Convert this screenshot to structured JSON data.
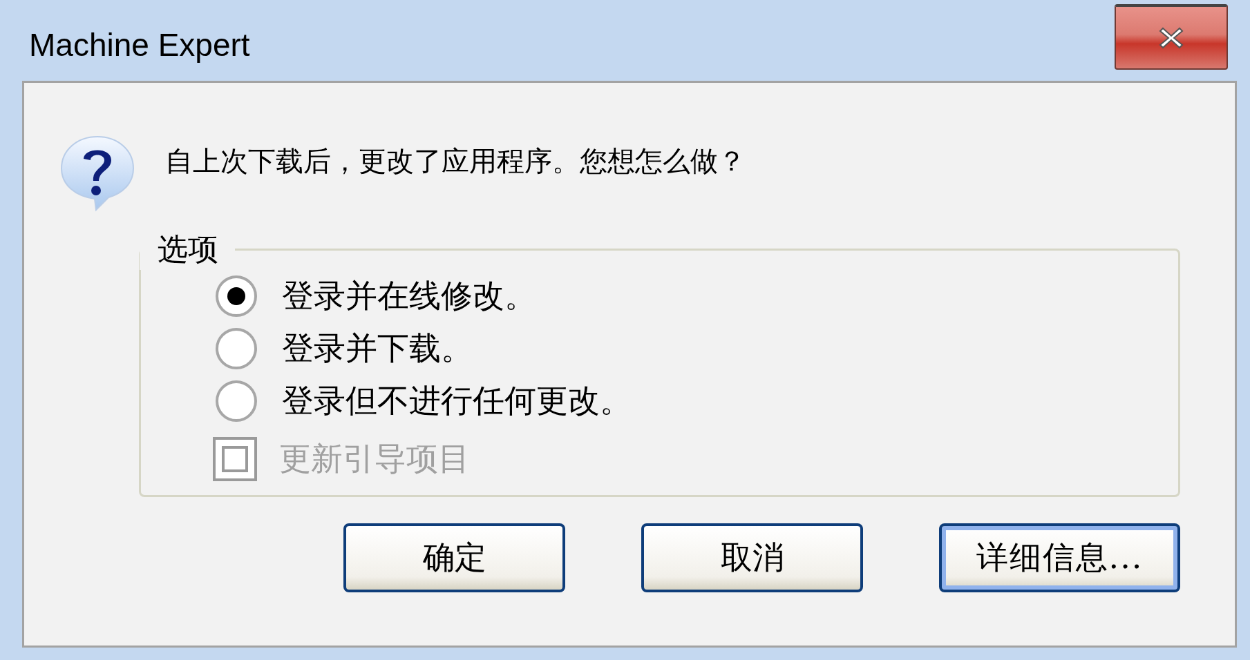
{
  "window": {
    "title": "Machine Expert"
  },
  "message": "自上次下载后，更改了应用程序。您想怎么做？",
  "options": {
    "legend": "选项",
    "items": [
      {
        "kind": "radio",
        "label": "登录并在线修改。",
        "selected": true
      },
      {
        "kind": "radio",
        "label": "登录并下载。",
        "selected": false
      },
      {
        "kind": "radio",
        "label": "登录但不进行任何更改。",
        "selected": false
      },
      {
        "kind": "checkbox",
        "label": "更新引导项目",
        "checked": false,
        "disabled": true
      }
    ]
  },
  "buttons": [
    {
      "label": "确定",
      "default": false
    },
    {
      "label": "取消",
      "default": false
    },
    {
      "label": "详细信息...",
      "default": true
    }
  ]
}
